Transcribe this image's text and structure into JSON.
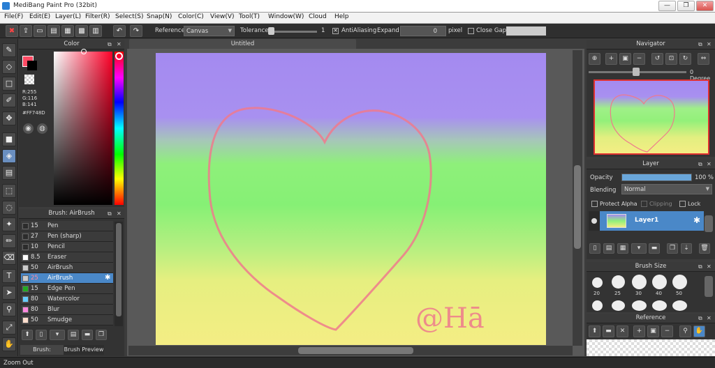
{
  "window": {
    "title": "MediBang Paint Pro (32bit)"
  },
  "menu": [
    "File(F)",
    "Edit(E)",
    "Layer(L)",
    "Filter(R)",
    "Select(S)",
    "Snap(N)",
    "Color(C)",
    "View(V)",
    "Tool(T)",
    "Window(W)",
    "Cloud",
    "Help"
  ],
  "toolbar": {
    "reference_label": "Reference",
    "reference_value": "Canvas",
    "tolerance_label": "Tolerance",
    "tolerance_value": "1",
    "antialiasing_label": "AntiAliasing",
    "expand_label": "Expand",
    "expand_value": "0",
    "expand_unit": "pixel",
    "close_gaps_label": "Close Gaps"
  },
  "color_panel": {
    "title": "Color",
    "r": "R:255",
    "g": "G:116",
    "b": "B:141",
    "hex": "#FF748D",
    "fg_color": "#FF748D"
  },
  "brush_panel": {
    "title": "Brush: AirBrush",
    "brushes": [
      {
        "size": "15",
        "name": "Pen",
        "color": "#2c2c2c"
      },
      {
        "size": "27",
        "name": "Pen (sharp)",
        "color": "#2c2c2c"
      },
      {
        "size": "10",
        "name": "Pencil",
        "color": "#2c2c2c"
      },
      {
        "size": "8.5",
        "name": "Eraser",
        "color": "#ffffff"
      },
      {
        "size": "50",
        "name": "AirBrush",
        "color": "#cccccc"
      },
      {
        "size": "25",
        "name": "AirBrush",
        "color": "#cccccc"
      },
      {
        "size": "15",
        "name": "Edge Pen",
        "color": "#22aa22"
      },
      {
        "size": "80",
        "name": "Watercolor",
        "color": "#66ccff"
      },
      {
        "size": "80",
        "name": "Blur",
        "color": "#ff88dd"
      },
      {
        "size": "50",
        "name": "Smudge",
        "color": "#ffddcc"
      }
    ],
    "tabs": [
      "Brush: AirBrush",
      "Brush Preview"
    ]
  },
  "canvas": {
    "tab_title": "Untitled",
    "signature": "@Hā"
  },
  "navigator": {
    "title": "Navigator",
    "angle": "0 Degree"
  },
  "layer_panel": {
    "title": "Layer",
    "opacity_label": "Opacity",
    "opacity_value": "100 %",
    "opacity_percent": 100,
    "blending_label": "Blending",
    "blending_value": "Normal",
    "protect_alpha": "Protect Alpha",
    "clipping": "Clipping",
    "lock": "Lock",
    "layer_name": "Layer1"
  },
  "brush_size_panel": {
    "title": "Brush Size",
    "sizes": [
      "20",
      "25",
      "30",
      "40",
      "50"
    ]
  },
  "reference_panel": {
    "title": "Reference"
  },
  "status": {
    "text": "Zoom Out"
  }
}
